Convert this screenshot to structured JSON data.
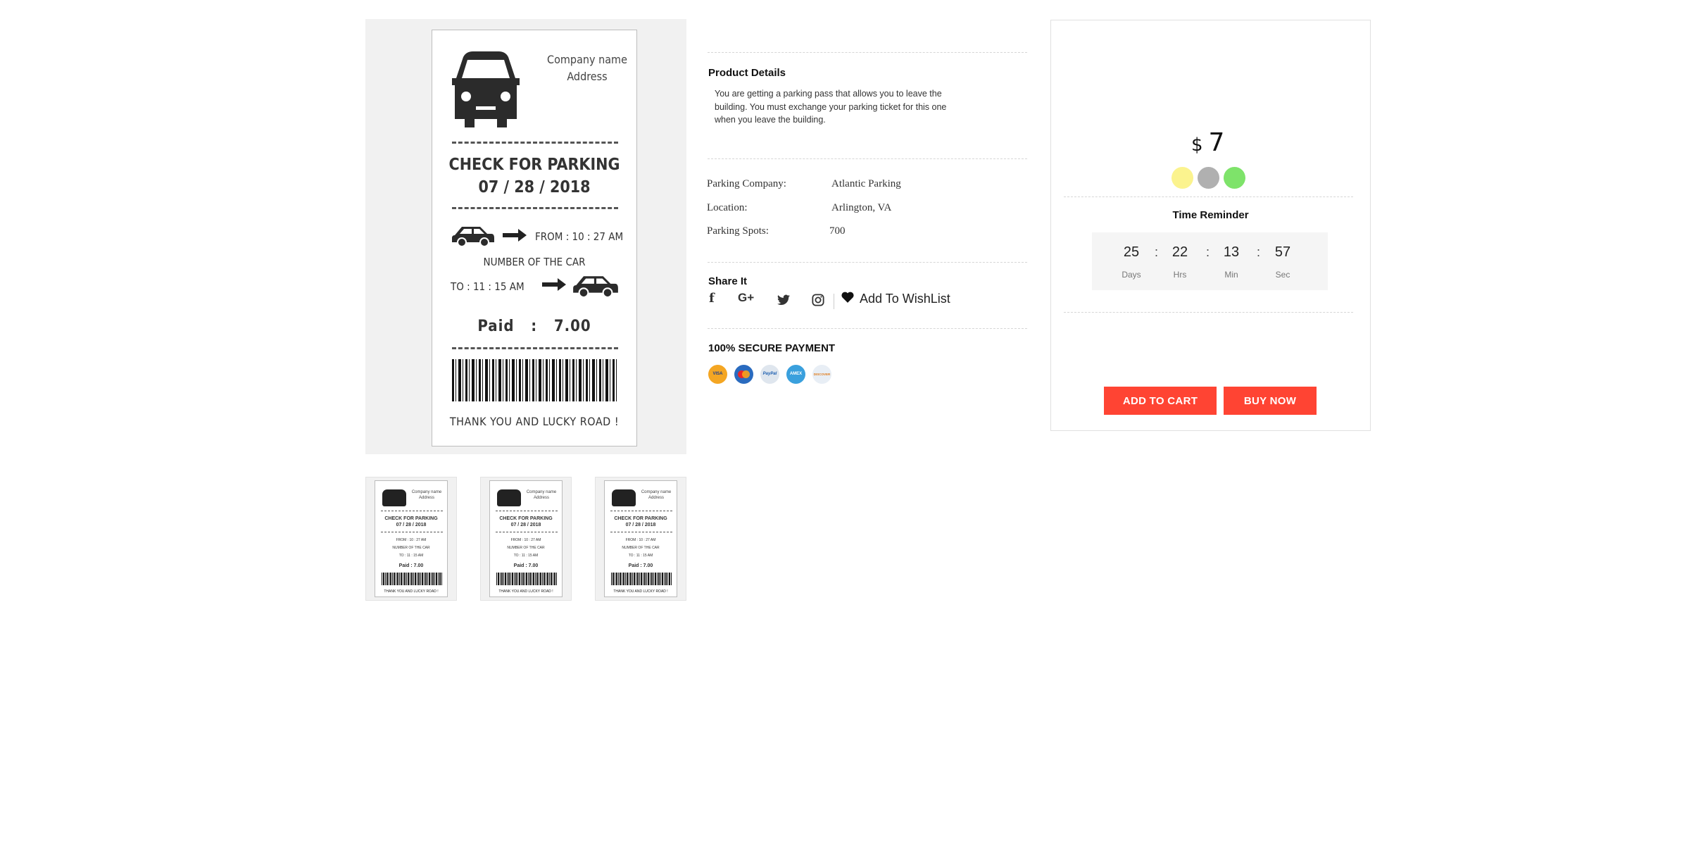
{
  "ticket": {
    "company_line1": "Company name",
    "company_line2": "Address",
    "title": "CHECK FOR PARKING",
    "date": "07 / 28 / 2018",
    "from": "FROM : 10 : 27 AM",
    "number_of_car": "NUMBER OF THE CAR",
    "to": "TO : 11 : 15 AM",
    "paid_label": "Paid",
    "paid_sep": ":",
    "paid_value": "7.00",
    "thanks": "THANK YOU AND LUCKY ROAD !"
  },
  "thumbnail_ticket": {
    "company_line1": "Company name",
    "company_line2": "Address",
    "title": "CHECK FOR PARKING",
    "date": "07 / 28 / 2018",
    "from": "FROM : 10 : 27 AM",
    "number_of_car": "NUMBER OF THE CAR",
    "to": "TO : 11 : 15 AM",
    "paid": "Paid  :  7.00",
    "thanks": "THANK YOU AND LUCKY ROAD !"
  },
  "details": {
    "heading": "Product Details",
    "description": "You are getting a parking pass that allows you to leave the building. You must exchange your parking ticket for this one when you leave the building.",
    "specs": [
      {
        "label": "Parking Company:",
        "value": "Atlantic Parking"
      },
      {
        "label": "Location:",
        "value": "Arlington, VA"
      },
      {
        "label": "Parking Spots:",
        "value": "700"
      }
    ],
    "share_heading": "Share It",
    "social_icons": [
      "facebook-icon",
      "google-plus-icon",
      "twitter-icon",
      "instagram-icon"
    ],
    "social_glyphs": {
      "facebook": "f",
      "google": "G+",
      "twitter": "🐦",
      "instagram": "◎"
    },
    "wishlist_icon": "heart-icon",
    "wishlist_label": "Add To WishList",
    "secure_heading": "100% SECURE PAYMENT",
    "payment_methods": [
      {
        "name": "visa-icon",
        "label": "VISA",
        "color": "#f4a623"
      },
      {
        "name": "mastercard-icon",
        "label": "MC",
        "color": "#2a6bbf"
      },
      {
        "name": "paypal-icon",
        "label": "PayPal",
        "color": "#dfe6ee"
      },
      {
        "name": "amex-icon",
        "label": "AMEX",
        "color": "#3aa0dd"
      },
      {
        "name": "discover-icon",
        "label": "DISCOVER",
        "color": "#e8eef5"
      }
    ]
  },
  "purchase": {
    "currency": "$",
    "price": "7",
    "colors": [
      "#fbf38e",
      "#b0b0b0",
      "#7ee36a"
    ],
    "timer_title": "Time Reminder",
    "timer": [
      {
        "value": "25",
        "label": "Days"
      },
      {
        "value": "22",
        "label": "Hrs"
      },
      {
        "value": "13",
        "label": "Min"
      },
      {
        "value": "57",
        "label": "Sec"
      }
    ],
    "timer_separator": ":",
    "add_to_cart": "ADD TO CART",
    "buy_now": "BUY NOW",
    "button_color": "#ff4433"
  }
}
